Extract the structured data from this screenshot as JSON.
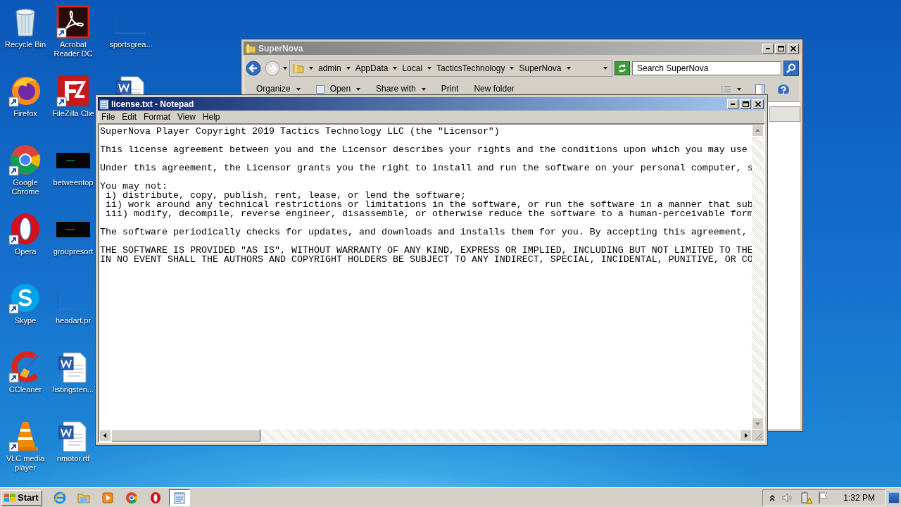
{
  "desktop_icons": [
    {
      "label": "Recycle Bin",
      "kind": "recycle",
      "shortcut": false
    },
    {
      "label": "Firefox",
      "kind": "firefox",
      "shortcut": true
    },
    {
      "label": "Google Chrome",
      "kind": "chrome",
      "shortcut": true
    },
    {
      "label": "Opera",
      "kind": "opera",
      "shortcut": true
    },
    {
      "label": "Skype",
      "kind": "skype",
      "shortcut": true
    },
    {
      "label": "CCleaner",
      "kind": "ccleaner",
      "shortcut": true
    },
    {
      "label": "VLC media player",
      "kind": "vlc",
      "shortcut": true
    },
    {
      "label": "Acrobat Reader DC",
      "kind": "acrobat",
      "shortcut": true
    },
    {
      "label": "FileZilla Clie",
      "kind": "filezilla",
      "shortcut": true
    },
    {
      "label": "betweentop",
      "kind": "thumb",
      "shortcut": false
    },
    {
      "label": "groupresort",
      "kind": "thumb",
      "shortcut": false
    },
    {
      "label": "headart.pr",
      "kind": "blank",
      "shortcut": false
    },
    {
      "label": "listingsten...",
      "kind": "word",
      "shortcut": false
    },
    {
      "label": "nmotor.rtf",
      "kind": "word",
      "shortcut": false
    },
    {
      "label": "sportsgrea...",
      "kind": "blank",
      "shortcut": false
    },
    {
      "kind": "word"
    }
  ],
  "explorer": {
    "title": "SuperNova",
    "active": false,
    "breadcrumbs": [
      "admin",
      "AppData",
      "Local",
      "TacticsTechnology",
      "SuperNova"
    ],
    "search": {
      "placeholder": "Search SuperNova"
    },
    "toolbar": [
      {
        "label": "Organize",
        "kind": "plain",
        "menu": true
      },
      {
        "label": "Open",
        "kind": "open",
        "menu": true
      },
      {
        "label": "Share with",
        "kind": "plain",
        "menu": true
      },
      {
        "label": "Print",
        "kind": "plain",
        "menu": false
      },
      {
        "label": "New folder",
        "kind": "plain",
        "menu": false
      }
    ]
  },
  "notepad": {
    "title": "license.txt - Notepad",
    "active": true,
    "menu": [
      "File",
      "Edit",
      "Format",
      "View",
      "Help"
    ],
    "paragraphs": [
      [
        "SuperNova Player Copyright 2019 Tactics Technology LLC (the \"Licensor\")"
      ],
      [
        "This license agreement between you and the Licensor describes your rights and the conditions upon which you may use"
      ],
      [
        "Under this agreement, the Licensor grants you the right to install and run the software on your personal computer, s"
      ],
      [
        "You may not:",
        " i) distribute, copy, publish, rent, lease, or lend the software;",
        " ii) work around any technical restrictions or limitations in the software, or run the software in a manner that sub",
        " iii) modify, decompile, reverse engineer, disassemble, or otherwise reduce the software to a human-perceivable form"
      ],
      [
        "The software periodically checks for updates, and downloads and installs them for you. By accepting this agreement,"
      ],
      [
        "THE SOFTWARE IS PROVIDED \"AS IS\", WITHOUT WARRANTY OF ANY KIND, EXPRESS OR IMPLIED, INCLUDING BUT NOT LIMITED TO THE",
        "IN NO EVENT SHALL THE AUTHORS AND COPYRIGHT HOLDERS BE SUBJECT TO ANY INDIRECT, SPECIAL, INCIDENTAL, PUNITIVE, OR CO"
      ]
    ]
  },
  "taskbar": {
    "start": "Start",
    "items": [
      {
        "kind": "ie",
        "selected": false
      },
      {
        "kind": "explorer",
        "selected": false
      },
      {
        "kind": "media",
        "selected": false
      },
      {
        "kind": "chrome",
        "selected": false
      },
      {
        "kind": "opera",
        "selected": false
      },
      {
        "kind": "notepad",
        "selected": true
      }
    ],
    "clock": "1:32 PM"
  }
}
